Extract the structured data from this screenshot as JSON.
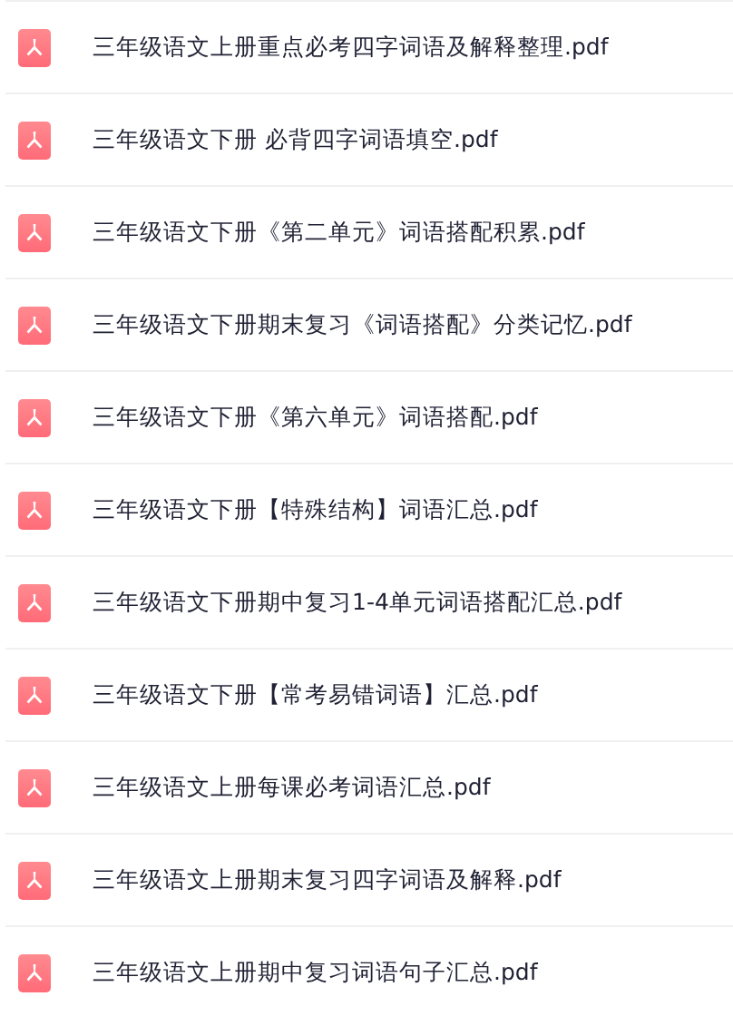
{
  "files": [
    {
      "name": "三年级语文上册重点必考四字词语及解释整理.pdf"
    },
    {
      "name": "三年级语文下册 必背四字词语填空.pdf"
    },
    {
      "name": "三年级语文下册《第二单元》词语搭配积累.pdf"
    },
    {
      "name": "三年级语文下册期末复习《词语搭配》分类记忆.pdf"
    },
    {
      "name": "三年级语文下册《第六单元》词语搭配.pdf"
    },
    {
      "name": "三年级语文下册【特殊结构】词语汇总.pdf"
    },
    {
      "name": "三年级语文下册期中复习1-4单元词语搭配汇总.pdf"
    },
    {
      "name": "三年级语文下册【常考易错词语】汇总.pdf"
    },
    {
      "name": "三年级语文上册每课必考词语汇总.pdf"
    },
    {
      "name": "三年级语文上册期末复习四字词语及解释.pdf"
    },
    {
      "name": "三年级语文上册期中复习词语句子汇总.pdf"
    }
  ]
}
